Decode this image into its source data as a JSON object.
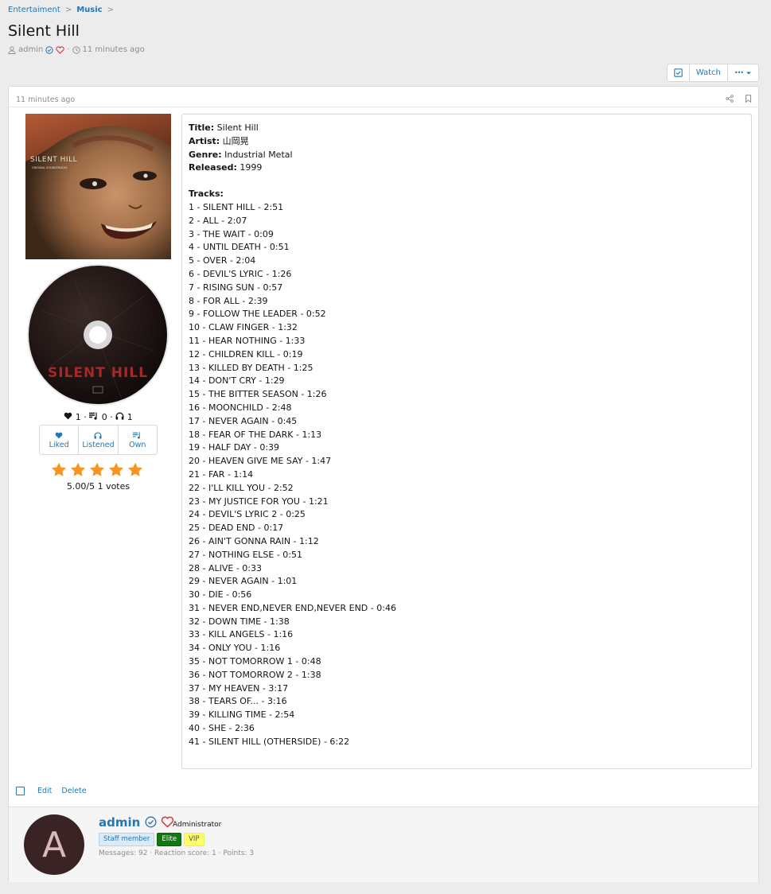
{
  "breadcrumb": {
    "items": [
      "Entertaiment",
      "Music"
    ],
    "separator": ">"
  },
  "thread": {
    "title": "Silent Hill",
    "author": "admin",
    "meta_separator": "·",
    "time": "11 minutes ago"
  },
  "toolbar": {
    "watch_label": "Watch",
    "more_label": "•••"
  },
  "post": {
    "time": "11 minutes ago",
    "album_cover_text": "SILENT HILL",
    "album_cover_subtext": "ORIGINAL SOUNDTRACKS",
    "disc_text": "SILENT HILL",
    "stats": {
      "likes": "1",
      "owns": "0",
      "listens": "1"
    },
    "actions": {
      "liked": "Liked",
      "listened": "Listened",
      "own": "Own"
    },
    "rating": {
      "stars": 5,
      "max": 5,
      "text": "5.00/5 1 votes"
    },
    "info": {
      "title_label": "Title:",
      "title_value": "Silent Hill",
      "artist_label": "Artist:",
      "artist_value": "山岡晃",
      "genre_label": "Genre:",
      "genre_value": "Industrial Metal",
      "released_label": "Released:",
      "released_value": "1999",
      "tracks_label": "Tracks:"
    },
    "tracks": [
      "1 - SILENT HILL - 2:51",
      "2 - ALL - 2:07",
      "3 - THE WAIT - 0:09",
      "4 - UNTIL DEATH - 0:51",
      "5 - OVER - 2:04",
      "6 - DEVIL'S LYRIC - 1:26",
      "7 - RISING SUN - 0:57",
      "8 - FOR ALL - 2:39",
      "9 - FOLLOW THE LEADER - 0:52",
      "10 - CLAW FINGER - 1:32",
      "11 - HEAR NOTHING - 1:33",
      "12 - CHILDREN KILL - 0:19",
      "13 - KILLED BY DEATH - 1:25",
      "14 - DON'T CRY - 1:29",
      "15 - THE BITTER SEASON - 1:26",
      "16 - MOONCHILD - 2:48",
      "17 - NEVER AGAIN - 0:45",
      "18 - FEAR OF THE DARK - 1:13",
      "19 - HALF DAY - 0:39",
      "20 - HEAVEN GIVE ME SAY - 1:47",
      "21 - FAR - 1:14",
      "22 - I'LL KILL YOU - 2:52",
      "23 - MY JUSTICE FOR YOU - 1:21",
      "24 - DEVIL'S LYRIC 2 - 0:25",
      "25 - DEAD END - 0:17",
      "26 - AIN'T GONNA RAIN - 1:12",
      "27 - NOTHING ELSE - 0:51",
      "28 - ALIVE - 0:33",
      "29 - NEVER AGAIN - 1:01",
      "30 - DIE - 0:56",
      "31 - NEVER END,NEVER END,NEVER END - 0:46",
      "32 - DOWN TIME - 1:38",
      "33 - KILL ANGELS - 1:16",
      "34 - ONLY YOU - 1:16",
      "35 - NOT TOMORROW 1 - 0:48",
      "36 - NOT TOMORROW 2 - 1:38",
      "37 - MY HEAVEN - 3:17",
      "38 - TEARS OF... - 3:16",
      "39 - KILLING TIME - 2:54",
      "40 - SHE - 2:36",
      "41 - SILENT HILL (OTHERSIDE) - 6:22"
    ],
    "footer": {
      "edit": "Edit",
      "delete": "Delete"
    }
  },
  "user": {
    "avatar_letter": "A",
    "name": "admin",
    "title": "Administrator",
    "banners": [
      "Staff member",
      "Elite",
      "VIP"
    ],
    "stats": "Messages: 92 · Reaction score: 1 · Points: 3"
  },
  "colors": {
    "link": "#2577b1",
    "star": "#f7941d",
    "heart": "#e0302f",
    "verified": "#2577b1"
  }
}
